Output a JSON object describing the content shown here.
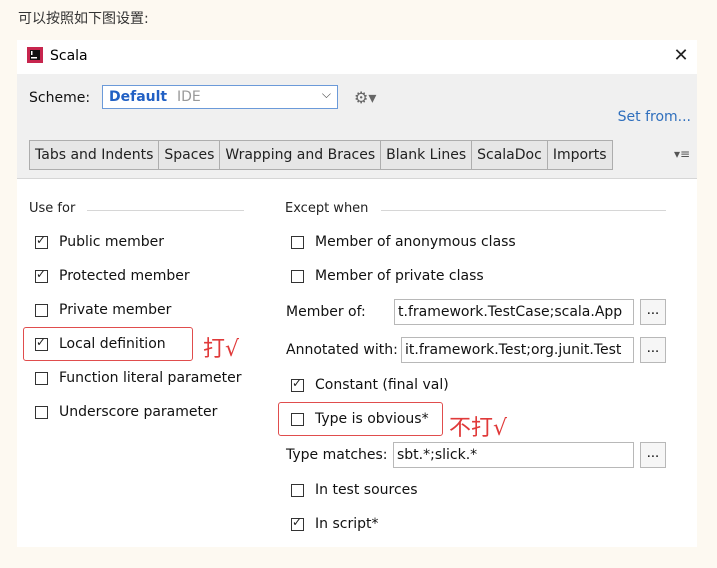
{
  "caption": "可以按照如下图设置:",
  "window": {
    "title": "Scala",
    "close_glyph": "✕",
    "app_icon": "intellij-app-icon"
  },
  "scheme": {
    "label": "Scheme:",
    "value": "Default",
    "suffix": "IDE",
    "arrow": "⌵",
    "gear": "⚙▾"
  },
  "set_from": "Set from...",
  "tabs": [
    "Tabs and Indents",
    "Spaces",
    "Wrapping and Braces",
    "Blank Lines",
    "ScalaDoc",
    "Imports"
  ],
  "tabs_menu": "▾≡",
  "use_for": {
    "title": "Use for",
    "items": [
      {
        "label": "Public member",
        "checked": true
      },
      {
        "label": "Protected member",
        "checked": true
      },
      {
        "label": "Private member",
        "checked": false
      },
      {
        "label": "Local definition",
        "checked": true
      },
      {
        "label": "Function literal parameter",
        "checked": false
      },
      {
        "label": "Underscore parameter",
        "checked": false
      }
    ]
  },
  "except_when": {
    "title": "Except when",
    "anonymous": {
      "label": "Member of anonymous class",
      "checked": false
    },
    "private_class": {
      "label": "Member of private class",
      "checked": false
    },
    "member_of": {
      "label": "Member of:",
      "value": "t.framework.TestCase;scala.App",
      "button": "..."
    },
    "annotated_with": {
      "label": "Annotated with:",
      "value": "it.framework.Test;org.junit.Test",
      "button": "..."
    },
    "constant": {
      "label": "Constant (final val)",
      "checked": true
    },
    "type_obvious": {
      "label": "Type is obvious*",
      "checked": false
    },
    "type_matches": {
      "label": "Type matches:",
      "value": "sbt.*;slick.*",
      "button": "..."
    },
    "in_test_sources": {
      "label": "In test sources",
      "checked": false
    },
    "in_script": {
      "label": "In script*",
      "checked": true
    }
  },
  "annotations": {
    "check": "打√",
    "uncheck": "不打√"
  },
  "colors": {
    "accent": "#2160c4",
    "link": "#2f6fbd",
    "annotation": "#e03a3a"
  }
}
